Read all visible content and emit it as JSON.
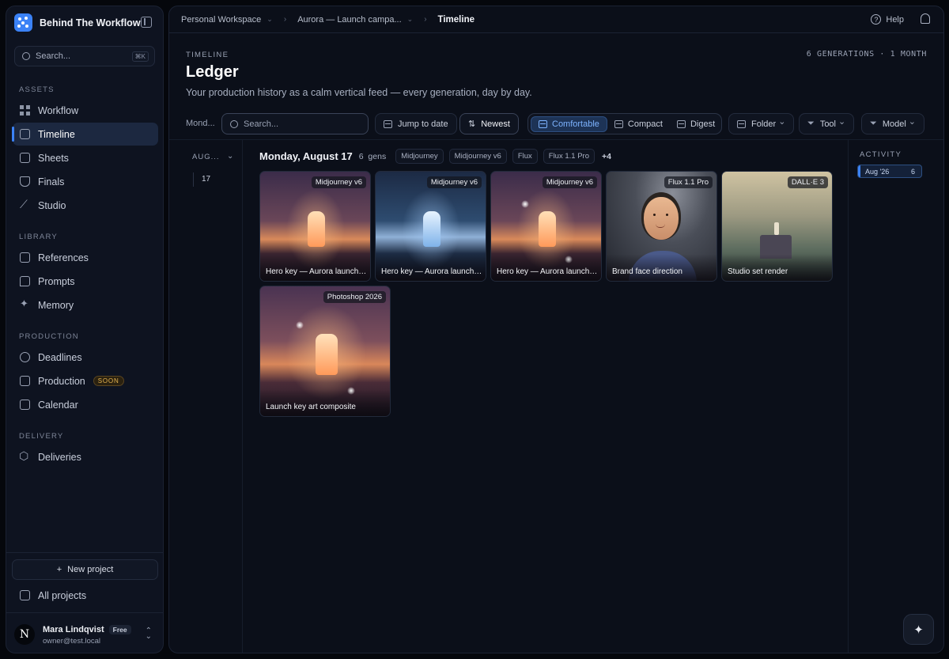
{
  "brand": {
    "name": "Behind The Workflow"
  },
  "search": {
    "placeholder": "Search...",
    "shortcut": "⌘K"
  },
  "sidebar": {
    "sections": [
      {
        "title": "ASSETS"
      },
      {
        "title": "LIBRARY"
      },
      {
        "title": "PRODUCTION"
      },
      {
        "title": "DELIVERY"
      }
    ],
    "items": [
      {
        "label": "Workflow",
        "icon": "grid-icon"
      },
      {
        "label": "Timeline",
        "icon": "calendar-icon",
        "active": true
      },
      {
        "label": "Sheets",
        "icon": "sheet-icon"
      },
      {
        "label": "Finals",
        "icon": "trophy-icon"
      },
      {
        "label": "Studio",
        "icon": "wand-icon"
      },
      {
        "label": "References",
        "icon": "image-icon"
      },
      {
        "label": "Prompts",
        "icon": "chat-icon"
      },
      {
        "label": "Memory",
        "icon": "sparkle-icon"
      },
      {
        "label": "Deadlines",
        "icon": "alarm-icon"
      },
      {
        "label": "Production",
        "icon": "clapper-icon",
        "badge": "SOON"
      },
      {
        "label": "Calendar",
        "icon": "calendar-icon"
      },
      {
        "label": "Deliveries",
        "icon": "package-icon"
      }
    ],
    "new_project": "New project",
    "all_projects": "All projects"
  },
  "user": {
    "name": "Mara Lindqvist",
    "plan": "Free",
    "email": "owner@test.local",
    "initial": "N"
  },
  "topbar": {
    "crumbs": [
      "Personal Workspace",
      "Aurora — Launch campa...",
      "Timeline"
    ],
    "help": "Help"
  },
  "page": {
    "eyebrow": "TIMELINE",
    "title": "Ledger",
    "subtitle": "Your production history as a calm vertical feed — every generation, day by day.",
    "stats": "6 GENERATIONS · 1 MONTH"
  },
  "toolbar": {
    "scope_label": "Mond...",
    "search_placeholder": "Search...",
    "jump": "Jump to date",
    "sort": "Newest",
    "density": [
      "Comfortable",
      "Compact",
      "Digest"
    ],
    "density_selected": "Comfortable",
    "filters": [
      "Folder",
      "Tool",
      "Model"
    ]
  },
  "rail": {
    "month": "AUG...",
    "day": "17"
  },
  "day": {
    "title": "Monday, August 17",
    "count": "6",
    "count_unit": "gens",
    "chips": [
      "Midjourney",
      "Midjourney v6",
      "Flux",
      "Flux 1.1 Pro"
    ],
    "more": "+4"
  },
  "cards": [
    {
      "badge": "Midjourney v6",
      "caption": "Hero key — Aurora launch ..."
    },
    {
      "badge": "Midjourney v6",
      "caption": "Hero key — Aurora launch ..."
    },
    {
      "badge": "Midjourney v6",
      "caption": "Hero key — Aurora launch ..."
    },
    {
      "badge": "Flux 1.1 Pro",
      "caption": "Brand face direction"
    },
    {
      "badge": "DALL·E 3",
      "caption": "Studio set render"
    },
    {
      "badge": "Photoshop 2026",
      "caption": "Launch key art composite"
    }
  ],
  "activity": {
    "title": "ACTIVITY",
    "month": "Aug '26",
    "count": "6"
  },
  "colors": {
    "accent": "#3b82f6",
    "background": "#0b0f19",
    "sidebar": "#0e1320",
    "soon": "#e6b450"
  }
}
